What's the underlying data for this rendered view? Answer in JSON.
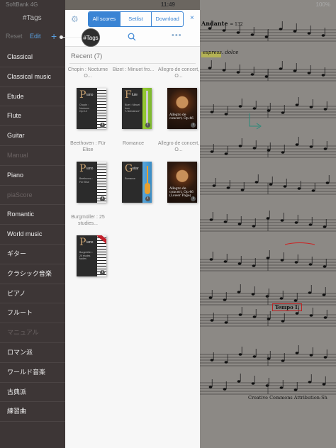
{
  "status": {
    "carrier": "SoftBank 4G",
    "time": "11:49",
    "battery": "100%"
  },
  "sidebar": {
    "title": "#Tags",
    "reset_label": "Reset",
    "edit_label": "Edit",
    "add_label": "+",
    "items": [
      {
        "label": "Classical",
        "dim": false
      },
      {
        "label": "Classical music",
        "dim": false
      },
      {
        "label": "Etude",
        "dim": false
      },
      {
        "label": "Flute",
        "dim": false
      },
      {
        "label": "Guitar",
        "dim": false
      },
      {
        "label": "Manual",
        "dim": true
      },
      {
        "label": "Piano",
        "dim": false
      },
      {
        "label": "piaScore",
        "dim": true
      },
      {
        "label": "Romantic",
        "dim": false
      },
      {
        "label": "World music",
        "dim": false
      },
      {
        "label": "ギター",
        "dim": false
      },
      {
        "label": "クラシック音楽",
        "dim": false
      },
      {
        "label": "ピアノ",
        "dim": false
      },
      {
        "label": "フルート",
        "dim": false
      },
      {
        "label": "マニュアル",
        "dim": true
      },
      {
        "label": "ロマン派",
        "dim": false
      },
      {
        "label": "ワールド音楽",
        "dim": false
      },
      {
        "label": "古典派",
        "dim": false
      },
      {
        "label": "練習曲",
        "dim": false
      }
    ]
  },
  "tag_badge": "#Tags",
  "panel": {
    "tabs": [
      {
        "label": "All scores",
        "active": true
      },
      {
        "label": "Setlist",
        "active": false
      },
      {
        "label": "Download",
        "active": false
      }
    ],
    "close_label": "×",
    "more_label": "•••",
    "recent_label": "Recent (7)",
    "scores": [
      {
        "caption": "Chopin : Nocturne O...",
        "type": "piano",
        "letter": "P",
        "sub": "iano",
        "desc": "Chopin : Nocturne Op.9-2",
        "badge": "i"
      },
      {
        "caption": "Bizet : Minuet fro...",
        "type": "flute",
        "letter": "F",
        "sub": "lute",
        "desc": "Bizet : Minuet from \"L'Arlesienne\"",
        "badge": "i"
      },
      {
        "caption": "Allegro de concert, O...",
        "type": "portrait",
        "ptext": "Allegro de concert, Op.46",
        "badge": "i"
      },
      {
        "caption": "Beethoven : Für Elise",
        "type": "piano",
        "letter": "P",
        "sub": "iano",
        "desc": "Beethoven : Für Elise",
        "badge": "i"
      },
      {
        "caption": "Romance",
        "type": "guitar",
        "letter": "G",
        "sub": "uitar",
        "desc": "Romance",
        "badge": "i"
      },
      {
        "caption": "Allegro de concert, O...",
        "type": "portrait",
        "ptext": "Allegro de concert, Op.46 (Lower Page)",
        "badge": "i"
      },
      {
        "caption": "Burgmüller : 25 studies...",
        "type": "piano-new",
        "letter": "P",
        "sub": "iano",
        "desc": "Burgmüller : 25 études faciles",
        "badge": "i"
      }
    ]
  },
  "sheet": {
    "tempo": "Andante",
    "metronome": "= 132",
    "expression": "espress. dolce",
    "tempo2": "Tempo I.",
    "license": "Creative Commons Attribution-Sh"
  },
  "colors": {
    "accent": "#3a84d4",
    "sidebar_bg": "#3d3636",
    "panel_bg": "#f7f7f7"
  }
}
